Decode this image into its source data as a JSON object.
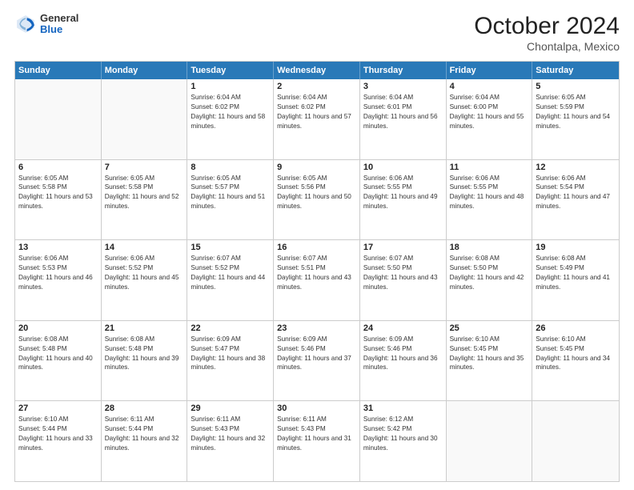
{
  "header": {
    "logo": {
      "general": "General",
      "blue": "Blue"
    },
    "title": "October 2024",
    "location": "Chontalpa, Mexico"
  },
  "calendar": {
    "days_of_week": [
      "Sunday",
      "Monday",
      "Tuesday",
      "Wednesday",
      "Thursday",
      "Friday",
      "Saturday"
    ],
    "weeks": [
      [
        {
          "day": "",
          "empty": true
        },
        {
          "day": "",
          "empty": true
        },
        {
          "day": "1",
          "sunrise": "6:04 AM",
          "sunset": "6:02 PM",
          "daylight": "11 hours and 58 minutes."
        },
        {
          "day": "2",
          "sunrise": "6:04 AM",
          "sunset": "6:02 PM",
          "daylight": "11 hours and 57 minutes."
        },
        {
          "day": "3",
          "sunrise": "6:04 AM",
          "sunset": "6:01 PM",
          "daylight": "11 hours and 56 minutes."
        },
        {
          "day": "4",
          "sunrise": "6:04 AM",
          "sunset": "6:00 PM",
          "daylight": "11 hours and 55 minutes."
        },
        {
          "day": "5",
          "sunrise": "6:05 AM",
          "sunset": "5:59 PM",
          "daylight": "11 hours and 54 minutes."
        }
      ],
      [
        {
          "day": "6",
          "sunrise": "6:05 AM",
          "sunset": "5:58 PM",
          "daylight": "11 hours and 53 minutes."
        },
        {
          "day": "7",
          "sunrise": "6:05 AM",
          "sunset": "5:58 PM",
          "daylight": "11 hours and 52 minutes."
        },
        {
          "day": "8",
          "sunrise": "6:05 AM",
          "sunset": "5:57 PM",
          "daylight": "11 hours and 51 minutes."
        },
        {
          "day": "9",
          "sunrise": "6:05 AM",
          "sunset": "5:56 PM",
          "daylight": "11 hours and 50 minutes."
        },
        {
          "day": "10",
          "sunrise": "6:06 AM",
          "sunset": "5:55 PM",
          "daylight": "11 hours and 49 minutes."
        },
        {
          "day": "11",
          "sunrise": "6:06 AM",
          "sunset": "5:55 PM",
          "daylight": "11 hours and 48 minutes."
        },
        {
          "day": "12",
          "sunrise": "6:06 AM",
          "sunset": "5:54 PM",
          "daylight": "11 hours and 47 minutes."
        }
      ],
      [
        {
          "day": "13",
          "sunrise": "6:06 AM",
          "sunset": "5:53 PM",
          "daylight": "11 hours and 46 minutes."
        },
        {
          "day": "14",
          "sunrise": "6:06 AM",
          "sunset": "5:52 PM",
          "daylight": "11 hours and 45 minutes."
        },
        {
          "day": "15",
          "sunrise": "6:07 AM",
          "sunset": "5:52 PM",
          "daylight": "11 hours and 44 minutes."
        },
        {
          "day": "16",
          "sunrise": "6:07 AM",
          "sunset": "5:51 PM",
          "daylight": "11 hours and 43 minutes."
        },
        {
          "day": "17",
          "sunrise": "6:07 AM",
          "sunset": "5:50 PM",
          "daylight": "11 hours and 43 minutes."
        },
        {
          "day": "18",
          "sunrise": "6:08 AM",
          "sunset": "5:50 PM",
          "daylight": "11 hours and 42 minutes."
        },
        {
          "day": "19",
          "sunrise": "6:08 AM",
          "sunset": "5:49 PM",
          "daylight": "11 hours and 41 minutes."
        }
      ],
      [
        {
          "day": "20",
          "sunrise": "6:08 AM",
          "sunset": "5:48 PM",
          "daylight": "11 hours and 40 minutes."
        },
        {
          "day": "21",
          "sunrise": "6:08 AM",
          "sunset": "5:48 PM",
          "daylight": "11 hours and 39 minutes."
        },
        {
          "day": "22",
          "sunrise": "6:09 AM",
          "sunset": "5:47 PM",
          "daylight": "11 hours and 38 minutes."
        },
        {
          "day": "23",
          "sunrise": "6:09 AM",
          "sunset": "5:46 PM",
          "daylight": "11 hours and 37 minutes."
        },
        {
          "day": "24",
          "sunrise": "6:09 AM",
          "sunset": "5:46 PM",
          "daylight": "11 hours and 36 minutes."
        },
        {
          "day": "25",
          "sunrise": "6:10 AM",
          "sunset": "5:45 PM",
          "daylight": "11 hours and 35 minutes."
        },
        {
          "day": "26",
          "sunrise": "6:10 AM",
          "sunset": "5:45 PM",
          "daylight": "11 hours and 34 minutes."
        }
      ],
      [
        {
          "day": "27",
          "sunrise": "6:10 AM",
          "sunset": "5:44 PM",
          "daylight": "11 hours and 33 minutes."
        },
        {
          "day": "28",
          "sunrise": "6:11 AM",
          "sunset": "5:44 PM",
          "daylight": "11 hours and 32 minutes."
        },
        {
          "day": "29",
          "sunrise": "6:11 AM",
          "sunset": "5:43 PM",
          "daylight": "11 hours and 32 minutes."
        },
        {
          "day": "30",
          "sunrise": "6:11 AM",
          "sunset": "5:43 PM",
          "daylight": "11 hours and 31 minutes."
        },
        {
          "day": "31",
          "sunrise": "6:12 AM",
          "sunset": "5:42 PM",
          "daylight": "11 hours and 30 minutes."
        },
        {
          "day": "",
          "empty": true
        },
        {
          "day": "",
          "empty": true
        }
      ]
    ]
  }
}
